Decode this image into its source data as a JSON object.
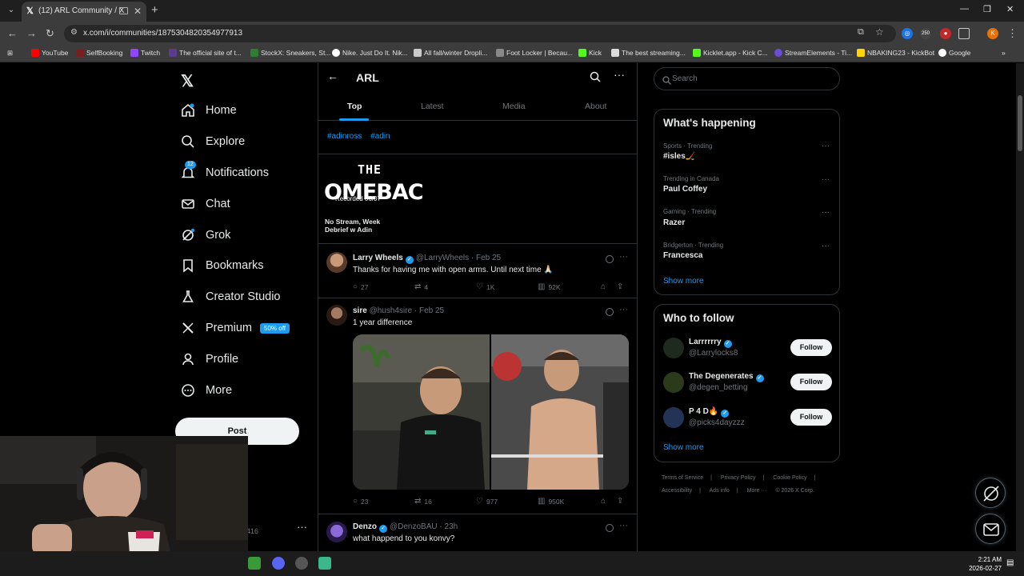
{
  "browser": {
    "tab_title": "(12) ARL Community / X",
    "url": "x.com/i/communities/1875304820354977913",
    "ext_badge": "250",
    "profile_initial": "K",
    "bookmarks": [
      "YouTube",
      "SelfBooking",
      "Twitch",
      "The official site of t...",
      "StockX: Sneakers, St...",
      "Nike. Just Do It. Nik...",
      "All fall/winter Dropli...",
      "Foot Locker | Becau...",
      "Kick",
      "The best streaming...",
      "Kicklet.app - Kick C...",
      "StreamElements - Ti...",
      "NBAKING23 - KickBot",
      "Google"
    ]
  },
  "sidebar": {
    "items": [
      {
        "label": "Home"
      },
      {
        "label": "Explore"
      },
      {
        "label": "Notifications",
        "badge": "12"
      },
      {
        "label": "Chat"
      },
      {
        "label": "Grok"
      },
      {
        "label": "Bookmarks"
      },
      {
        "label": "Creator Studio"
      },
      {
        "label": "Premium",
        "badge": "50% off"
      },
      {
        "label": "Profile"
      },
      {
        "label": "More"
      }
    ],
    "post_label": "Post",
    "account_fragment": "416"
  },
  "community": {
    "name": "ARL",
    "tabs": [
      "Top",
      "Latest",
      "Media",
      "About"
    ],
    "hashtags": [
      "#adinross",
      "#adin"
    ],
    "pinned": {
      "thumb_top": "THE",
      "thumb_big": "OMEBAC",
      "thumb_rec": "Recorded 06/07",
      "caption": "No Stream, Week Debrief w Adin"
    }
  },
  "tweets": [
    {
      "name": "Larry Wheels",
      "handle": "@LarryWheels",
      "date": "Feb 25",
      "text": "Thanks for having me with open arms. Until next time 🙏🏻",
      "replies": "27",
      "reposts": "4",
      "likes": "1K",
      "views": "92K"
    },
    {
      "name": "sire",
      "handle": "@hush4sire",
      "date": "Feb 25",
      "text": "1 year difference",
      "replies": "23",
      "reposts": "16",
      "likes": "977",
      "views": "950K"
    },
    {
      "name": "Denzo",
      "handle": "@DenzoBAU",
      "date": "23h",
      "text": "what happend to you konvy?"
    }
  ],
  "right": {
    "search_placeholder": "Search",
    "happening_title": "What's happening",
    "trends": [
      {
        "meta": "Sports · Trending",
        "name": "#isles🏒"
      },
      {
        "meta": "Trending in Canada",
        "name": "Paul Coffey"
      },
      {
        "meta": "Gaming · Trending",
        "name": "Razer"
      },
      {
        "meta": "Bridgerton · Trending",
        "name": "Francesca"
      }
    ],
    "show_more": "Show more",
    "wtf_title": "Who to follow",
    "follow_label": "Follow",
    "wtf": [
      {
        "name": "Larrrrrry",
        "handle": "@Larrylocks8"
      },
      {
        "name": "The Degenerates",
        "handle": "@degen_betting"
      },
      {
        "name": "P 4 D🔥",
        "handle": "@picks4dayzzz"
      }
    ],
    "footer": [
      "Terms of Service",
      "|",
      "Privacy Policy",
      "|",
      "Cookie Policy",
      "|",
      "Accessibility",
      "|",
      "Ads info",
      "|",
      "More ···",
      "© 2026 X Corp."
    ]
  },
  "taskbar": {
    "time": "2:21 AM",
    "date": "2026-02-27"
  },
  "colors": {
    "accent": "#1d9bf0",
    "bg": "#000000",
    "border": "#2f3336",
    "muted": "#71767b"
  }
}
